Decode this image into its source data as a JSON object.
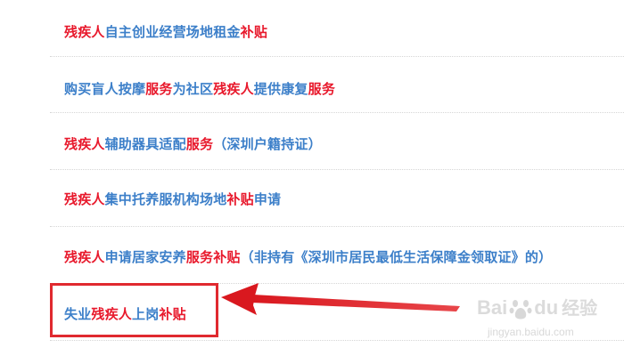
{
  "links": [
    {
      "segments": [
        {
          "text": "残疾人",
          "color": "red"
        },
        {
          "text": "自主创业经营场地租金",
          "color": "blue"
        },
        {
          "text": "补贴",
          "color": "red"
        }
      ]
    },
    {
      "segments": [
        {
          "text": "购买盲人按摩",
          "color": "blue"
        },
        {
          "text": "服务",
          "color": "red"
        },
        {
          "text": "为社区",
          "color": "blue"
        },
        {
          "text": "残疾人",
          "color": "red"
        },
        {
          "text": "提供康复",
          "color": "blue"
        },
        {
          "text": "服务",
          "color": "red"
        }
      ]
    },
    {
      "segments": [
        {
          "text": "残疾人",
          "color": "red"
        },
        {
          "text": "辅助器具适配",
          "color": "blue"
        },
        {
          "text": "服务",
          "color": "red"
        },
        {
          "text": "（深圳户籍持证）",
          "color": "blue"
        }
      ]
    },
    {
      "segments": [
        {
          "text": "残疾人",
          "color": "red"
        },
        {
          "text": "集中托养服机构场地",
          "color": "blue"
        },
        {
          "text": "补贴",
          "color": "red"
        },
        {
          "text": "申请",
          "color": "blue"
        }
      ]
    },
    {
      "segments": [
        {
          "text": "残疾人",
          "color": "red"
        },
        {
          "text": "申请居家安养",
          "color": "blue"
        },
        {
          "text": "服务补贴",
          "color": "red"
        },
        {
          "text": "（非持有《深圳市居民最低生活保障金领取证》的）",
          "color": "blue"
        }
      ]
    },
    {
      "segments": [
        {
          "text": "失业",
          "color": "blue"
        },
        {
          "text": "残疾人",
          "color": "red"
        },
        {
          "text": "上岗",
          "color": "blue"
        },
        {
          "text": "补贴",
          "color": "red"
        }
      ]
    }
  ],
  "colors": {
    "red": "#e8192c",
    "blue": "#3c7fc9",
    "annotation": "#e0292f"
  },
  "watermark": {
    "logo_text_a": "Bai",
    "logo_text_b": "du",
    "logo_text_cn": "经验",
    "url": "jingyan.baidu.com",
    "icon": "baidu-paw-icon"
  }
}
